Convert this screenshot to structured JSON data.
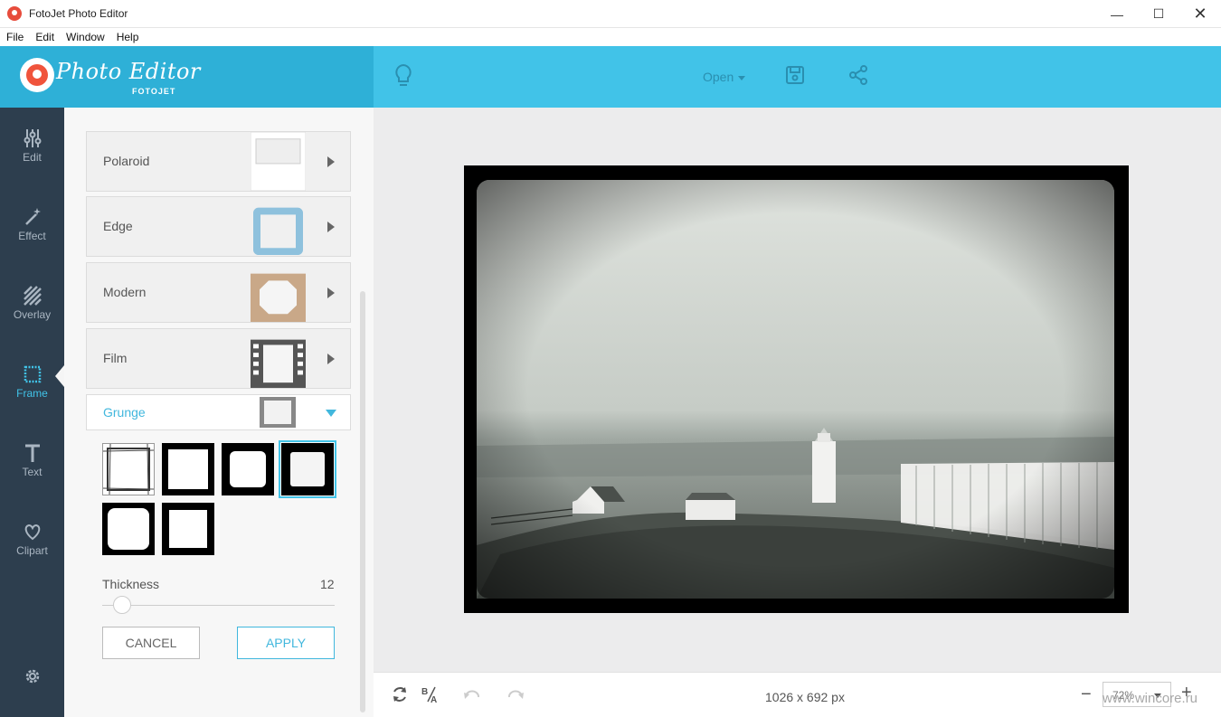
{
  "window": {
    "title": "FotoJet Photo Editor",
    "controls": {
      "minimize": "—",
      "maximize": "☐",
      "close": "✕"
    }
  },
  "menu": [
    "File",
    "Edit",
    "Window",
    "Help"
  ],
  "header": {
    "logo_text": "Photo Editor",
    "logo_sub": "FOTOJET",
    "open_label": "Open",
    "accent_color": "#41c3e8"
  },
  "nav": {
    "items": [
      {
        "label": "Edit",
        "icon": "sliders-icon"
      },
      {
        "label": "Effect",
        "icon": "magic-wand-icon"
      },
      {
        "label": "Overlay",
        "icon": "stripes-icon"
      },
      {
        "label": "Frame",
        "icon": "frame-icon",
        "active": true
      },
      {
        "label": "Text",
        "icon": "text-icon"
      },
      {
        "label": "Clipart",
        "icon": "heart-icon"
      }
    ]
  },
  "panel": {
    "frames": [
      "Polaroid",
      "Edge",
      "Modern",
      "Film"
    ],
    "grunge_label": "Grunge",
    "thickness_label": "Thickness",
    "thickness_value": "12",
    "thickness_fraction": 0.05,
    "cancel_label": "CANCEL",
    "apply_label": "APPLY"
  },
  "bottom": {
    "dimensions": "1026 x 692 px",
    "zoom_value": "72%",
    "zoom_minus": "−",
    "zoom_plus": "+",
    "watermark": "www.wincore.ru"
  }
}
